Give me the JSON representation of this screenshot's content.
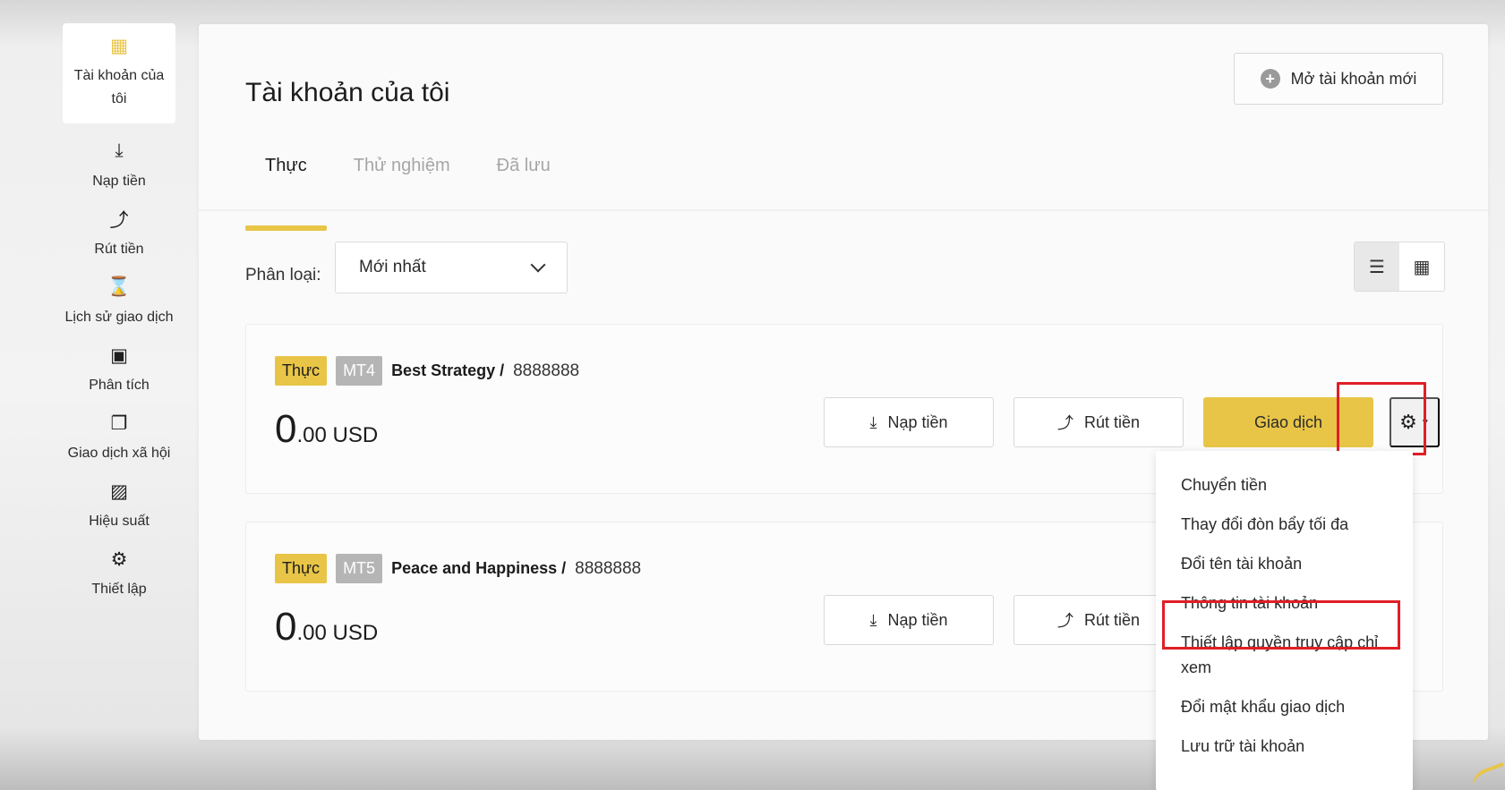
{
  "sidebar": {
    "items": [
      {
        "label": "Tài khoản của tôi",
        "icon": "grid-icon",
        "active": true
      },
      {
        "label": "Nạp tiền",
        "icon": "download-icon"
      },
      {
        "label": "Rút tiền",
        "icon": "upload-icon"
      },
      {
        "label": "Lịch sử giao dịch",
        "icon": "hourglass-icon"
      },
      {
        "label": "Phân tích",
        "icon": "chart-icon"
      },
      {
        "label": "Giao dịch xã hội",
        "icon": "copy-icon"
      },
      {
        "label": "Hiệu suất",
        "icon": "performance-icon"
      },
      {
        "label": "Thiết lập",
        "icon": "gear-icon"
      }
    ]
  },
  "header": {
    "title": "Tài khoản của tôi",
    "open_account_label": "Mở tài khoản mới"
  },
  "tabs": [
    {
      "label": "Thực",
      "active": true
    },
    {
      "label": "Thử nghiệm"
    },
    {
      "label": "Đã lưu"
    }
  ],
  "filter": {
    "label": "Phân loại:",
    "value": "Mới nhất"
  },
  "accounts": [
    {
      "type_badge": "Thực",
      "platform": "MT4",
      "name": "Best Strategy /",
      "number": "8888888",
      "balance_int": "0",
      "balance_rest": ".00 USD"
    },
    {
      "type_badge": "Thực",
      "platform": "MT5",
      "name": "Peace and Happiness /",
      "number": "8888888",
      "balance_int": "0",
      "balance_rest": ".00 USD"
    }
  ],
  "actions": {
    "deposit": "Nạp tiền",
    "withdraw": "Rút tiền",
    "trade": "Giao dịch"
  },
  "menu": {
    "items": [
      "Chuyển tiền",
      "Thay đổi đòn bẩy tối đa",
      "Đổi tên tài khoản",
      "Thông tin tài khoản",
      "Thiết lập quyền truy cập chỉ xem",
      "Đổi mật khẩu giao dịch",
      "Lưu trữ tài khoản"
    ]
  },
  "colors": {
    "accent": "#e8c547",
    "highlight": "#e01e26"
  }
}
